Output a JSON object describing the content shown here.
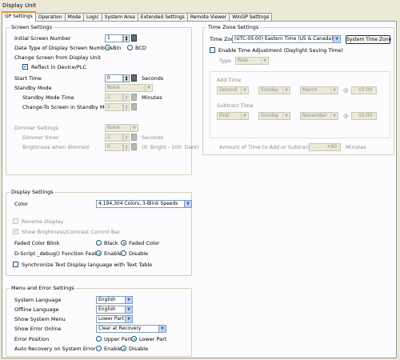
{
  "window_title": "Display Unit",
  "tabs": [
    "GP Settings",
    "Operation",
    "Mode",
    "Logic",
    "System Area",
    "Extended Settings",
    "Remote Viewer",
    "WinGP Settings"
  ],
  "screen": {
    "group_title": "Screen Settings",
    "initial_screen_label": "Initial Screen Number",
    "initial_screen_value": "1",
    "data_type_label": "Data Type of Display Screen Numbers",
    "bin_label": "Bin",
    "bcd_label": "BCD",
    "change_screen_label": "Change Screen from Display Unit",
    "reflect_label": "Reflect in Device/PLC",
    "start_time_label": "Start Time",
    "start_time_value": "0",
    "seconds": "Seconds",
    "standby_mode_label": "Standby Mode",
    "standby_mode_value": "None",
    "standby_time_label": "Standby Mode Time",
    "standby_time_value": "1",
    "minutes": "Minutes",
    "change_to_label": "Change-To Screen in Standby Mode",
    "change_to_value": "1",
    "dimmer_label": "Dimmer Settings",
    "dimmer_value": "None",
    "dimmer_timer_label": "Dimmer timer",
    "dimmer_timer_value": "1",
    "brightness_label": "Brightness when dimmed",
    "brightness_value": "0",
    "brightness_note": "(0: Bright - 100: Dark)"
  },
  "timezone": {
    "group_title": "Time Zone Settings",
    "time_zone_label": "Time Zone",
    "time_zone_value": "(UTC-05:00) Eastern Time (US & Canada)",
    "system_time_zone_button": "System Time Zone",
    "enable_adjust_label": "Enable Time Adjustment (Daylight Saving Time)",
    "type_label": "Type",
    "type_value": "Rule",
    "add_time_label": "Add Time",
    "add": [
      "Second",
      "Sunday",
      "March",
      "@",
      "02:00"
    ],
    "subtract_time_label": "Subtract Time",
    "subtract": [
      "First",
      "Sunday",
      "November",
      "@",
      "02:00"
    ],
    "amount_label": "Amount of Time to Add or Subtract",
    "amount_value": "+60",
    "amount_unit": "Minutes"
  },
  "display": {
    "group_title": "Display Settings",
    "color_label": "Color",
    "color_value": "4,194,304 Colors, 3-Blink Speeds",
    "reverse_label": "Reverse Display",
    "show_brightness_label": "Show Brightness/Contrast Control Bar",
    "faded_blink_label": "Faded Color Blink",
    "black_label": "Black",
    "faded_color_label": "Faded Color",
    "dscript_label": "D-Script _debug() Function Feat",
    "enable_label": "Enable",
    "disable_label": "Disable",
    "sync_label": "Synchronize Text Display language with Text Table"
  },
  "menu": {
    "group_title": "Menu and Error Settings",
    "system_language_label": "System Language",
    "system_language_value": "English",
    "offline_language_label": "Offline Language",
    "offline_language_value": "English",
    "show_system_menu_label": "Show System Menu",
    "show_system_menu_value": "Lower Part",
    "show_error_online_label": "Show Error Online",
    "show_error_online_value": "Clear at Recovery",
    "error_position_label": "Error Position",
    "upper_part_label": "Upper Part",
    "lower_part_label": "Lower Part",
    "auto_recovery_label": "Auto Recovery on System Error",
    "enable_label": "Enable",
    "disable_label": "Disable"
  }
}
